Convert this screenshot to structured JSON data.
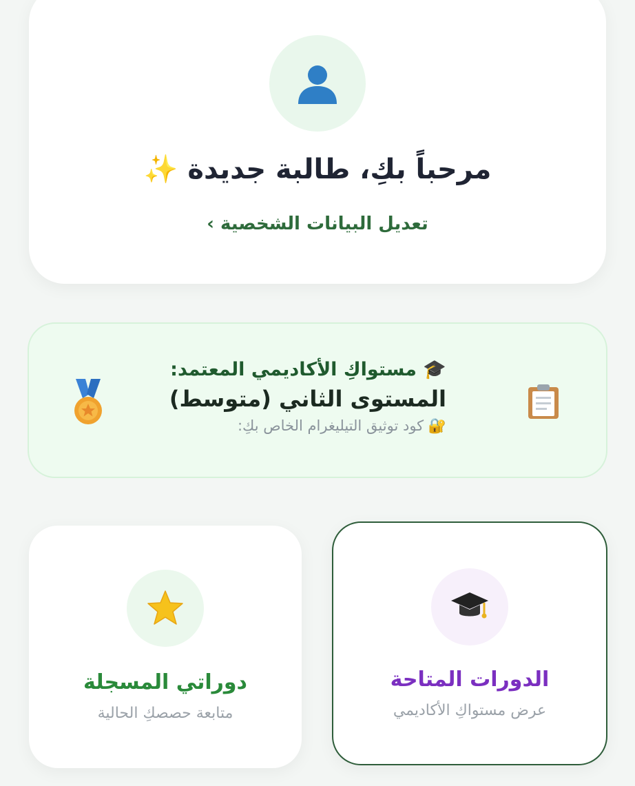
{
  "welcome": {
    "title": "مرحباً بكِ، طالبة جديدة",
    "sparkle": "✨",
    "edit_link": "تعديل البيانات الشخصية ›"
  },
  "level": {
    "label": "🎓 مستواكِ الأكاديمي المعتمد:",
    "value": "المستوى الثاني (متوسط)",
    "hint": "🔐 كود توثيق التيليغرام الخاص بكِ:"
  },
  "cards": {
    "available": {
      "title": "الدورات المتاحة",
      "subtitle": "عرض مستواكِ الأكاديمي"
    },
    "mine": {
      "title": "دوراتي المسجلة",
      "subtitle": "متابعة حصصكِ الحالية"
    }
  },
  "icons": {
    "avatar": "user-silhouette-icon",
    "level_left": "medal-icon",
    "level_right": "clipboard-icon",
    "available": "graduation-cap-icon",
    "mine": "star-icon"
  },
  "colors": {
    "available_title": "#7b2fc0",
    "mine_title": "#2a8a3a",
    "edit_link": "#2e6b3b"
  }
}
